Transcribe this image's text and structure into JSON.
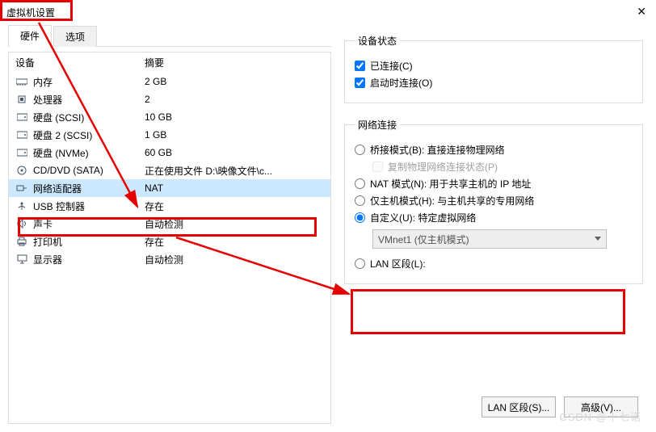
{
  "window": {
    "title": "虚拟机设置",
    "close": "✕"
  },
  "tabs": {
    "hardware": "硬件",
    "options": "选项"
  },
  "columns": {
    "device": "设备",
    "summary": "摘要"
  },
  "devices": [
    {
      "icon": "memory-icon",
      "name": "内存",
      "summary": "2 GB"
    },
    {
      "icon": "cpu-icon",
      "name": "处理器",
      "summary": "2"
    },
    {
      "icon": "disk-icon",
      "name": "硬盘 (SCSI)",
      "summary": "10 GB"
    },
    {
      "icon": "disk-icon",
      "name": "硬盘 2 (SCSI)",
      "summary": "1 GB"
    },
    {
      "icon": "disk-icon",
      "name": "硬盘 (NVMe)",
      "summary": "60 GB"
    },
    {
      "icon": "cd-icon",
      "name": "CD/DVD (SATA)",
      "summary": "正在使用文件 D:\\映像文件\\c..."
    },
    {
      "icon": "network-icon",
      "name": "网络适配器",
      "summary": "NAT"
    },
    {
      "icon": "usb-icon",
      "name": "USB 控制器",
      "summary": "存在"
    },
    {
      "icon": "sound-icon",
      "name": "声卡",
      "summary": "自动检测"
    },
    {
      "icon": "printer-icon",
      "name": "打印机",
      "summary": "存在"
    },
    {
      "icon": "display-icon",
      "name": "显示器",
      "summary": "自动检测"
    }
  ],
  "state": {
    "legend": "设备状态",
    "connected": "已连接(C)",
    "connect_power": "启动时连接(O)"
  },
  "net": {
    "legend": "网络连接",
    "bridged": "桥接模式(B): 直接连接物理网络",
    "replicate": "复制物理网络连接状态(P)",
    "nat": "NAT 模式(N): 用于共享主机的 IP 地址",
    "hostonly": "仅主机模式(H): 与主机共享的专用网络",
    "custom": "自定义(U): 特定虚拟网络",
    "custom_value": "VMnet1 (仅主机模式)",
    "lan": "LAN 区段(L):"
  },
  "buttons": {
    "lan": "LAN 区段(S)...",
    "advanced": "高级(V)..."
  },
  "watermark": "CSDN @十七诺"
}
